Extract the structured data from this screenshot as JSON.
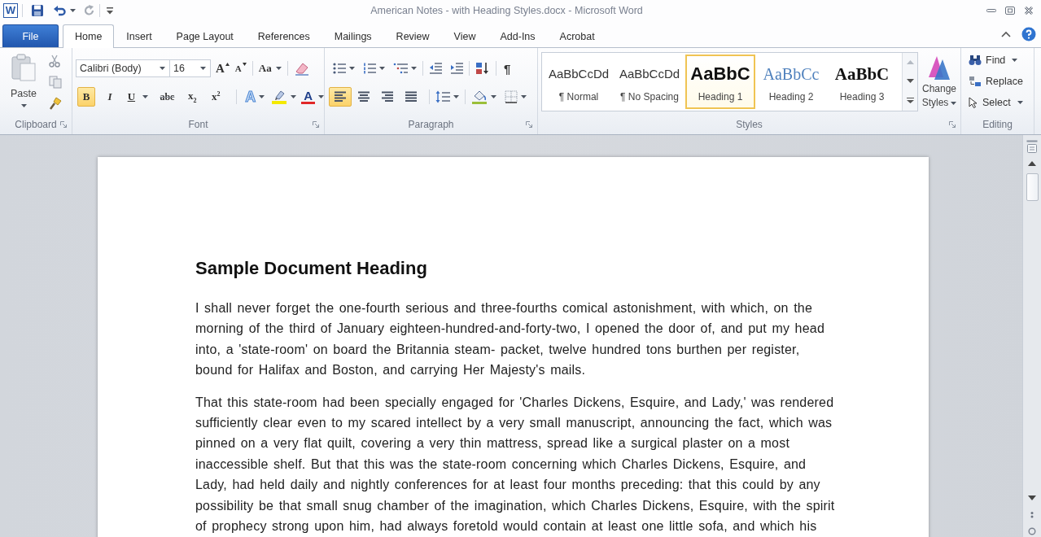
{
  "window": {
    "app_logo": "W",
    "title": "American Notes - with Heading Styles.docx - Microsoft Word"
  },
  "quick_access": {
    "undo": {
      "disabled": false
    },
    "redo": {
      "disabled": true
    }
  },
  "tabs": [
    {
      "label": "File",
      "kind": "file",
      "selected": false
    },
    {
      "label": "Home",
      "kind": "tab",
      "selected": true
    },
    {
      "label": "Insert",
      "kind": "tab",
      "selected": false
    },
    {
      "label": "Page Layout",
      "kind": "tab",
      "selected": false
    },
    {
      "label": "References",
      "kind": "tab",
      "selected": false
    },
    {
      "label": "Mailings",
      "kind": "tab",
      "selected": false
    },
    {
      "label": "Review",
      "kind": "tab",
      "selected": false
    },
    {
      "label": "View",
      "kind": "tab",
      "selected": false
    },
    {
      "label": "Add-Ins",
      "kind": "tab",
      "selected": false
    },
    {
      "label": "Acrobat",
      "kind": "tab",
      "selected": false
    }
  ],
  "clipboard": {
    "label": "Clipboard",
    "launcher": true,
    "paste": "Paste"
  },
  "font": {
    "label": "Font",
    "launcher": true,
    "font_name": "Calibri (Body)",
    "font_size": "16",
    "grow_font": "A",
    "shrink_font": "A",
    "change_case": "Aa",
    "formats": [
      {
        "kind": "bold",
        "label": "B",
        "on": true,
        "menu": false
      },
      {
        "kind": "italic",
        "label": "I",
        "on": false,
        "menu": false
      },
      {
        "kind": "underline",
        "label": "U",
        "on": false,
        "menu": true
      },
      {
        "kind": "strikethrough",
        "label": "abc",
        "on": false,
        "menu": false
      },
      {
        "kind": "subscript",
        "label": "x$_{2}$",
        "on": false,
        "menu": false
      },
      {
        "kind": "superscript",
        "label": "x$^{2}$",
        "on": false,
        "menu": false
      }
    ],
    "text_effects": "A",
    "font_color": "A"
  },
  "paragraph": {
    "label": "Paragraph",
    "launcher": true,
    "show_marks": "¶",
    "alignment": [
      {
        "kind": "left",
        "selected": true
      },
      {
        "kind": "center",
        "selected": false
      },
      {
        "kind": "right",
        "selected": false
      },
      {
        "kind": "justify",
        "selected": false
      }
    ]
  },
  "styles": {
    "label": "Styles",
    "launcher": true,
    "gallery": [
      {
        "kind": "normal",
        "preview": "AaBbCcDd",
        "name": "¶ Normal",
        "selected": false
      },
      {
        "kind": "no_spacing",
        "preview": "AaBbCcDd",
        "name": "¶ No Spacing",
        "selected": false
      },
      {
        "kind": "heading1",
        "preview": "AaBbC",
        "name": "Heading 1",
        "selected": true
      },
      {
        "kind": "heading2",
        "preview": "AaBbCc",
        "name": "Heading 2",
        "selected": false
      },
      {
        "kind": "heading3",
        "preview": "AaBbC",
        "name": "Heading 3",
        "selected": false
      }
    ],
    "change_styles": "Change Styles"
  },
  "editing": {
    "label": "Editing",
    "items": [
      {
        "kind": "find",
        "label": "Find",
        "menu": true
      },
      {
        "kind": "replace",
        "label": "Replace",
        "menu": false
      },
      {
        "kind": "select",
        "label": "Select",
        "menu": true
      }
    ]
  },
  "document": {
    "heading": "Sample Document Heading",
    "paragraphs": [
      "I shall never forget the one-fourth serious and three-fourths comical astonishment, with which, on the morning of the third of January eighteen-hundred-and-forty-two, I opened the door of, and put my head into, a 'state-room' on board the Britannia steam- packet, twelve hundred tons burthen per register, bound for Halifax and Boston, and carrying Her Majesty's mails.",
      "That this state-room had been specially engaged for 'Charles Dickens, Esquire, and Lady,' was rendered sufficiently clear even to my scared intellect by a very small manuscript, announcing the fact, which was pinned on a very flat quilt, covering a very thin mattress, spread like a surgical plaster on a most inaccessible shelf. But that this was the state-room concerning which Charles Dickens, Esquire, and Lady, had held daily and nightly conferences for at least four months preceding: that this could by any possibility be that small snug chamber of the imagination, which Charles Dickens, Esquire, with the spirit of prophecy strong upon him, had always foretold would contain at least one little sofa, and which his"
    ]
  }
}
